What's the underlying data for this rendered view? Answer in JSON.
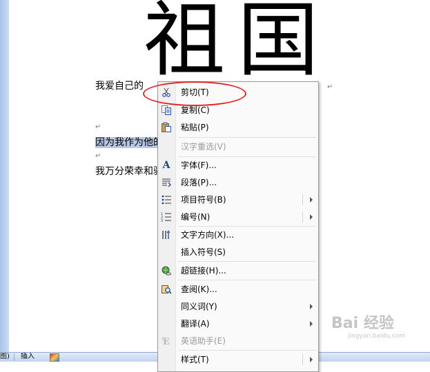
{
  "document": {
    "big_title": "祖国",
    "line1": "我爱自己的",
    "line3_selected": "因为我作为他的",
    "line4": "我万分荣幸和骄",
    "paragraph_mark": "↵"
  },
  "taskbar": {
    "item_left": "图)",
    "item_insert": "插入"
  },
  "context_menu": {
    "items": [
      {
        "label": "剪切(T)",
        "icon": "scissors-icon"
      },
      {
        "label": "复制(C)",
        "icon": "copy-icon"
      },
      {
        "label": "粘贴(P)",
        "icon": "paste-icon"
      },
      {
        "label": "汉字重选(V)",
        "icon": "",
        "disabled": true
      },
      {
        "label": "字体(F)...",
        "icon": "font-icon",
        "glyph": "A"
      },
      {
        "label": "段落(P)...",
        "icon": "paragraph-icon"
      },
      {
        "label": "项目符号(B)",
        "icon": "bullets-icon",
        "submenu": true
      },
      {
        "label": "编号(N)",
        "icon": "numbering-icon",
        "submenu": true
      },
      {
        "label": "文字方向(X)...",
        "icon": "text-direction-icon"
      },
      {
        "label": "插入符号(S)",
        "icon": ""
      },
      {
        "label": "超链接(H)...",
        "icon": "hyperlink-icon"
      },
      {
        "label": "查阅(K)...",
        "icon": "lookup-icon"
      },
      {
        "label": "同义词(Y)",
        "icon": "",
        "submenu": true
      },
      {
        "label": "翻译(A)",
        "icon": "",
        "submenu": true
      },
      {
        "label": "英语助手(E)",
        "icon": "english-assistant-icon",
        "disabled": true
      },
      {
        "label": "样式(T)",
        "icon": "",
        "submenu": true
      }
    ]
  },
  "watermark": {
    "main": "Bai 经验",
    "sub": "jingyan.baidu.com"
  },
  "colors": {
    "highlight_ellipse": "#e32323",
    "selection": "#b8c8e4"
  }
}
